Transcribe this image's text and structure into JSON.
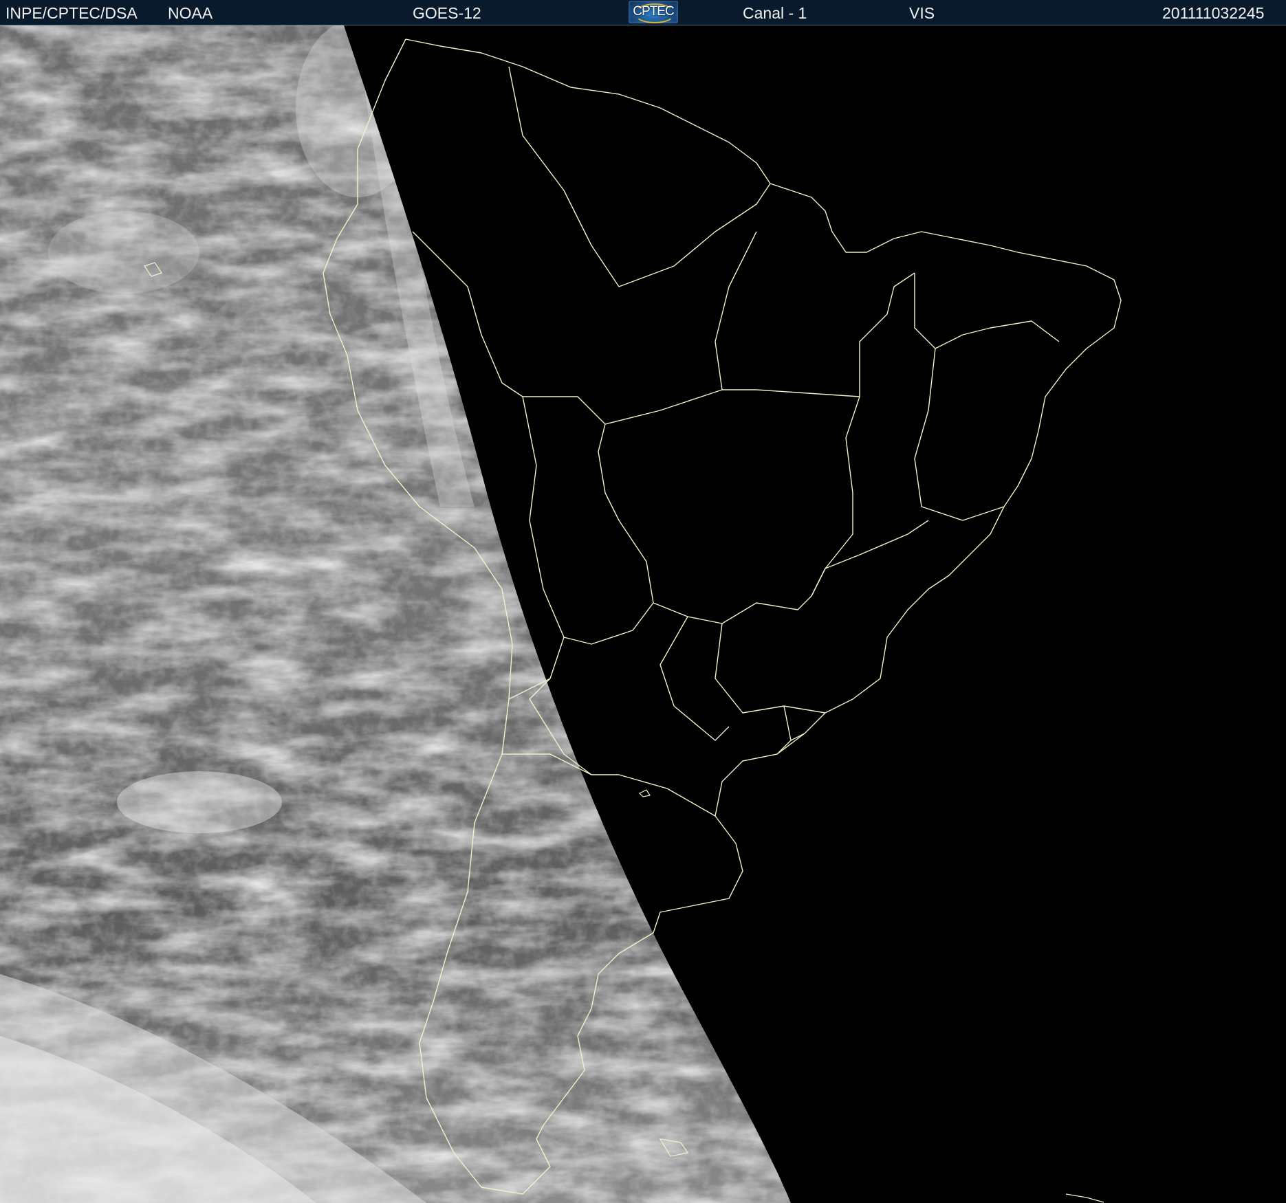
{
  "header": {
    "source": "INPE/CPTEC/DSA",
    "agency": "NOAA",
    "satellite": "GOES-12",
    "logo_text": "CPTEC",
    "channel": "Canal - 1",
    "band": "VIS",
    "timestamp": "201111032245"
  },
  "map": {
    "view": "satellite-visible-imagery",
    "region": "South America",
    "illuminated_side": "west",
    "colors": {
      "background": "#000000",
      "borders": "#f2f2c8",
      "header_bg": "#091a2c",
      "header_text": "#f2f2f2"
    }
  }
}
